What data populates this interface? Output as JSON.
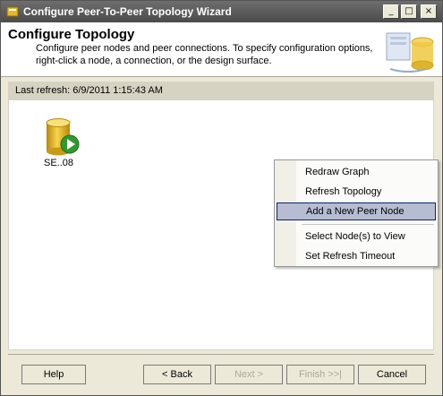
{
  "window": {
    "title": "Configure Peer-To-Peer Topology Wizard",
    "controls": {
      "minimize": "_",
      "maximize": "□",
      "close": "×"
    }
  },
  "header": {
    "title": "Configure Topology",
    "description": "Configure peer nodes and peer connections. To specify configuration options, right-click a node, a connection, or the design surface."
  },
  "status": {
    "last_refresh": "Last refresh: 6/9/2011 1:15:43 AM"
  },
  "node": {
    "label": "SE..08",
    "icon": "database-play-icon"
  },
  "context_menu": {
    "items": [
      {
        "label": "Redraw Graph"
      },
      {
        "label": "Refresh Topology"
      },
      {
        "label": "Add a New Peer Node",
        "highlighted": true
      },
      {
        "label": "Select Node(s) to View"
      },
      {
        "label": "Set Refresh Timeout"
      }
    ]
  },
  "buttons": {
    "help": "Help",
    "back": "< Back",
    "next": "Next >",
    "finish": "Finish >>|",
    "cancel": "Cancel"
  },
  "colors": {
    "menu_highlight": "#b6bdd2",
    "menu_highlight_border": "#0a246a",
    "database_gold": "#e8b828",
    "play_green": "#2f9a2f"
  }
}
